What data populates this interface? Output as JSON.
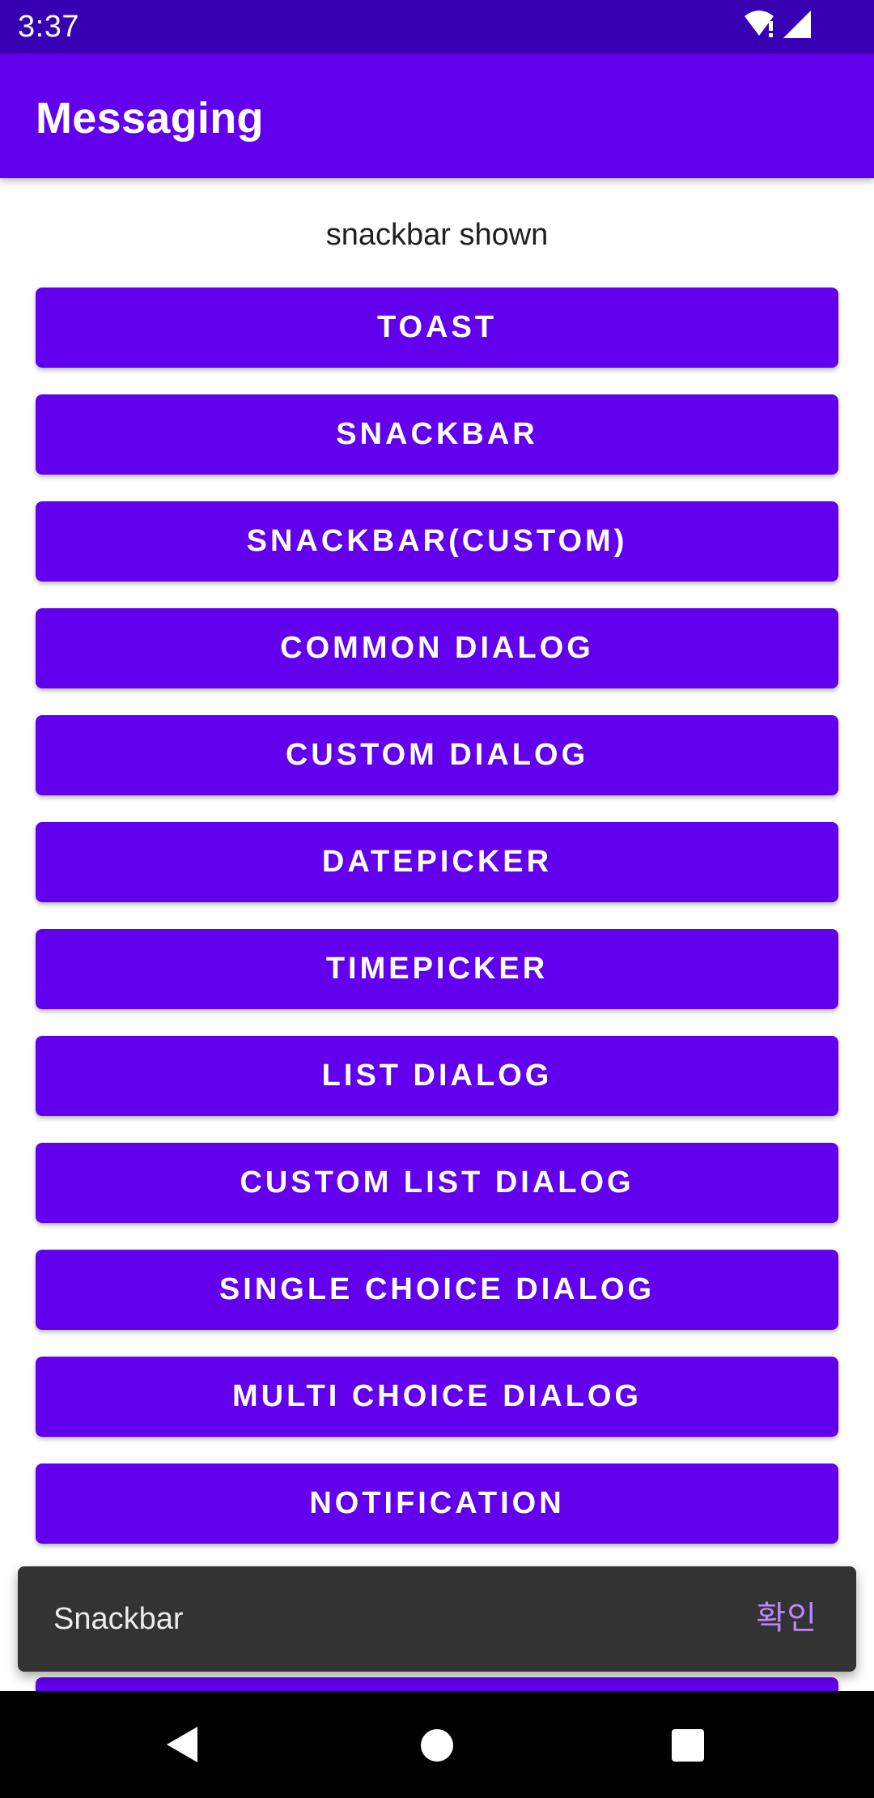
{
  "status_bar": {
    "time": "3:37",
    "icons": [
      "wifi-alert-icon",
      "signal-icon"
    ]
  },
  "app_bar": {
    "title": "Messaging"
  },
  "status_message": "snackbar shown",
  "buttons": [
    "TOAST",
    "SNACKBAR",
    "SNACKBAR(CUSTOM)",
    "COMMON DIALOG",
    "CUSTOM DIALOG",
    "DATEPICKER",
    "TIMEPICKER",
    "LIST DIALOG",
    "CUSTOM LIST DIALOG",
    "SINGLE CHOICE DIALOG",
    "MULTI CHOICE DIALOG",
    "NOTIFICATION",
    ""
  ],
  "snackbar": {
    "text": "Snackbar",
    "action": "확인"
  },
  "nav_bar": {
    "icons": [
      "back-icon",
      "home-icon",
      "recents-icon"
    ]
  },
  "colors": {
    "status_bar": "#3700b3",
    "primary": "#6200ee",
    "snackbar_bg": "#333333",
    "snackbar_action": "#bb86fc"
  }
}
